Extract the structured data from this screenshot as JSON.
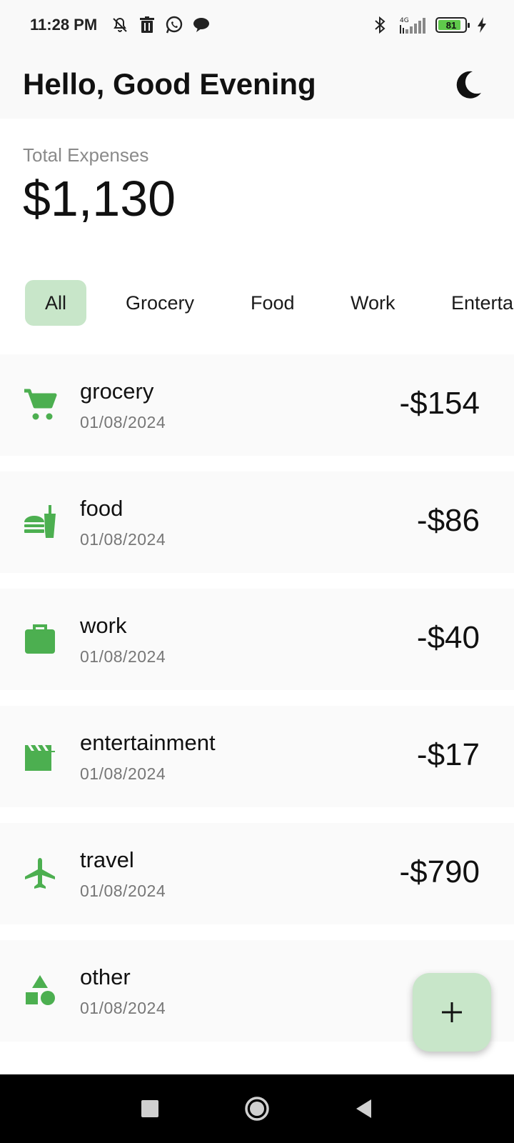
{
  "status_bar": {
    "time": "11:28 PM",
    "left_icons": [
      "mute-icon",
      "trash-icon",
      "whatsapp-icon",
      "chat-icon"
    ],
    "right_icons": [
      "bluetooth-icon",
      "signal-icon",
      "battery-icon",
      "charging-icon"
    ],
    "network_label": "4G",
    "battery_level": "81"
  },
  "header": {
    "greeting": "Hello, Good Evening",
    "theme_icon": "moon-icon"
  },
  "summary": {
    "label": "Total Expenses",
    "total": "$1,130"
  },
  "filters": {
    "selected": "All",
    "items": [
      "All",
      "Grocery",
      "Food",
      "Work",
      "Enterta"
    ]
  },
  "expenses": [
    {
      "title": "grocery",
      "date": "01/08/2024",
      "amount": "-$154",
      "icon": "cart-icon"
    },
    {
      "title": "food",
      "date": "01/08/2024",
      "amount": "-$86",
      "icon": "fastfood-icon"
    },
    {
      "title": "work",
      "date": "01/08/2024",
      "amount": "-$40",
      "icon": "briefcase-icon"
    },
    {
      "title": "entertainment",
      "date": "01/08/2024",
      "amount": "-$17",
      "icon": "clapperboard-icon"
    },
    {
      "title": "travel",
      "date": "01/08/2024",
      "amount": "-$790",
      "icon": "airplane-icon"
    },
    {
      "title": "other",
      "date": "01/08/2024",
      "amount": "",
      "icon": "shapes-icon"
    }
  ],
  "fab": {
    "icon": "plus-icon"
  },
  "nav": {
    "icons": [
      "recents-icon",
      "home-icon",
      "back-icon"
    ]
  },
  "colors": {
    "accent": "#4caf50",
    "chip_selected_bg": "#c8e6c9",
    "fab_bg": "#c8e6c9",
    "row_bg": "#fafafa",
    "app_bar_bg": "#f9f9f9"
  }
}
